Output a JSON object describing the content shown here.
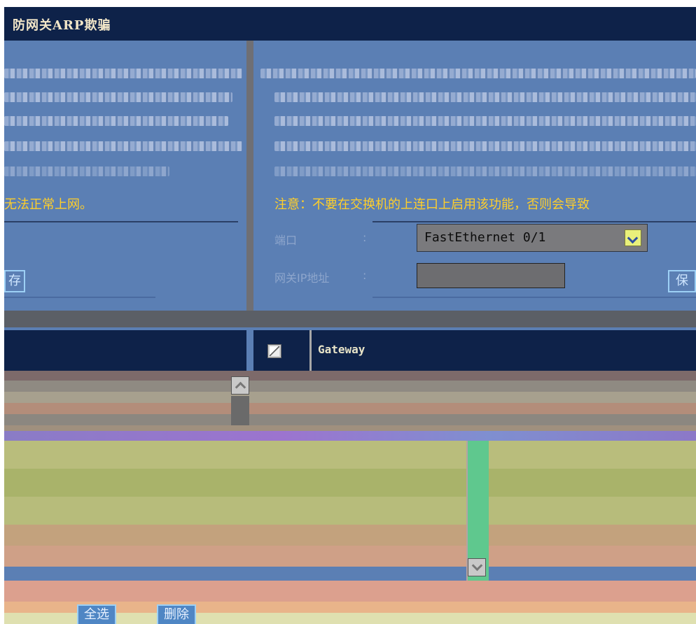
{
  "title": "防网关ARP欺骗",
  "left_panel": {
    "warning_text": "无法正常上网。",
    "save_button": "存"
  },
  "right_panel": {
    "warning_text": "注意：不要在交换机的上连口上启用该功能，否则会导致",
    "port_label": "端口",
    "port_colon": ":",
    "port_value": "FastEthernet 0/1",
    "gateway_ip_label": "网关IP地址",
    "gateway_ip_colon": ":",
    "gateway_ip_value": "",
    "save_button": "保"
  },
  "table": {
    "gateway_header": "Gateway"
  },
  "actions": {
    "select_all": "全选",
    "delete": "删除"
  }
}
